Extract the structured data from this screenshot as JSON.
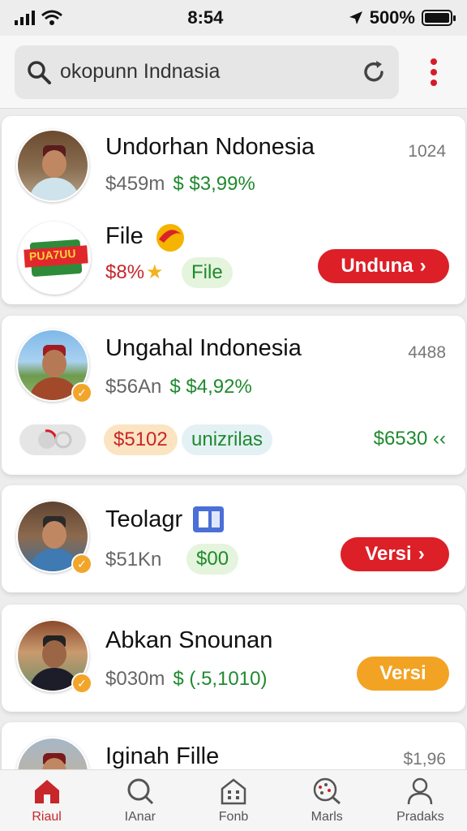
{
  "status": {
    "time": "8:54",
    "battery": "500%"
  },
  "search": {
    "query": "okopunn Indnasia"
  },
  "cards": [
    {
      "title": "Undorhan Ndonesia",
      "count": "1024",
      "meta_left": "$459m",
      "meta_right": "$ $3,99%",
      "sub_title": "File",
      "sub_left": "$8%",
      "sub_pill": "File",
      "button": "Unduna",
      "logo_text": "PUA7UU"
    },
    {
      "title": "Ungahal Indonesia",
      "count": "4488",
      "meta_left": "$56An",
      "meta_right": "$ $4,92%",
      "pill_orange": "$5102",
      "pill_blue": "unizrilas",
      "value_right": "$6530 ‹‹"
    },
    {
      "title": "Teolagr",
      "meta_left": "$51Kn",
      "pill_green": "$00",
      "button": "Versi"
    },
    {
      "title": "Abkan Snounan",
      "meta_left": "$030m",
      "meta_right": "$ (.5,1010)",
      "button": "Versi"
    },
    {
      "title": "Iginah Fille",
      "count": "$1,96"
    }
  ],
  "tabs": [
    {
      "label": "Riaul",
      "icon": "home-icon",
      "active": true
    },
    {
      "label": "IAnar",
      "icon": "search-icon",
      "active": false
    },
    {
      "label": "Fonb",
      "icon": "building-icon",
      "active": false
    },
    {
      "label": "Marls",
      "icon": "map-search-icon",
      "active": false
    },
    {
      "label": "Pradaks",
      "icon": "user-icon",
      "active": false
    }
  ],
  "colors": {
    "accent_red": "#dd1f28",
    "accent_orange": "#f2a324",
    "green": "#1f8a2e"
  }
}
